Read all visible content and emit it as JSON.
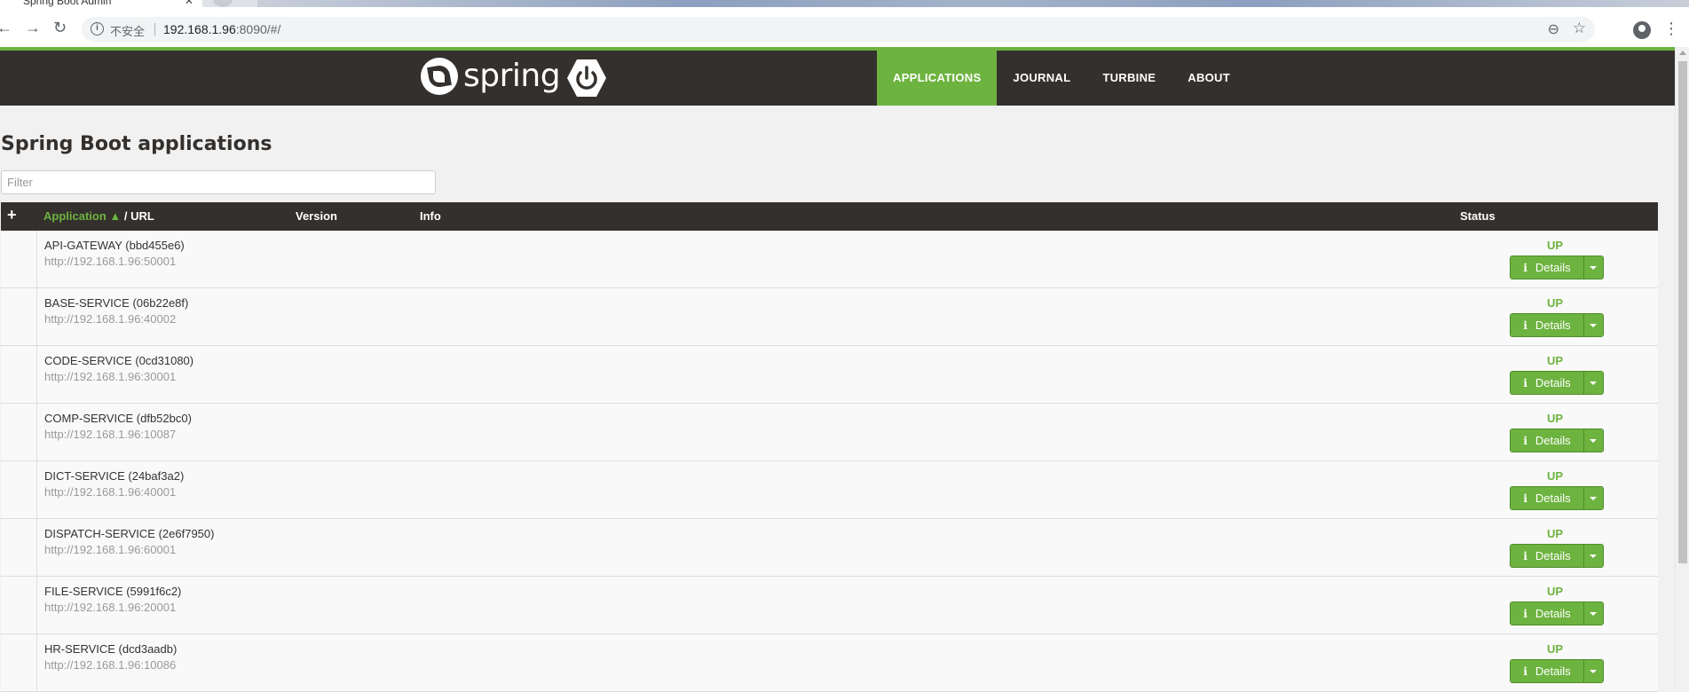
{
  "browser": {
    "tab_title": "Spring Boot Admin",
    "tab_close": "✕",
    "security_label": "不安全",
    "url_host": "192.168.1.96",
    "url_rest": ":8090/#/"
  },
  "header": {
    "logo_text": "spring",
    "nav": [
      {
        "label": "APPLICATIONS",
        "active": true
      },
      {
        "label": "JOURNAL",
        "active": false
      },
      {
        "label": "TURBINE",
        "active": false
      },
      {
        "label": "ABOUT",
        "active": false
      }
    ]
  },
  "colors": {
    "accent": "#6db33f",
    "header_bg": "#34302d"
  },
  "main": {
    "title": "Spring Boot applications",
    "filter_placeholder": "Filter",
    "columns": {
      "expand": "+",
      "application": "Application",
      "sort_indicator": "▲",
      "url": "/ URL",
      "version": "Version",
      "info": "Info",
      "status": "Status"
    },
    "details_label": "Details",
    "applications": [
      {
        "name": "API-GATEWAY (bbd455e6)",
        "url": "http://192.168.1.96:50001",
        "status": "UP"
      },
      {
        "name": "BASE-SERVICE (06b22e8f)",
        "url": "http://192.168.1.96:40002",
        "status": "UP"
      },
      {
        "name": "CODE-SERVICE (0cd31080)",
        "url": "http://192.168.1.96:30001",
        "status": "UP"
      },
      {
        "name": "COMP-SERVICE (dfb52bc0)",
        "url": "http://192.168.1.96:10087",
        "status": "UP"
      },
      {
        "name": "DICT-SERVICE (24baf3a2)",
        "url": "http://192.168.1.96:40001",
        "status": "UP"
      },
      {
        "name": "DISPATCH-SERVICE (2e6f7950)",
        "url": "http://192.168.1.96:60001",
        "status": "UP"
      },
      {
        "name": "FILE-SERVICE (5991f6c2)",
        "url": "http://192.168.1.96:20001",
        "status": "UP"
      },
      {
        "name": "HR-SERVICE (dcd3aadb)",
        "url": "http://192.168.1.96:10086",
        "status": "UP"
      }
    ]
  }
}
